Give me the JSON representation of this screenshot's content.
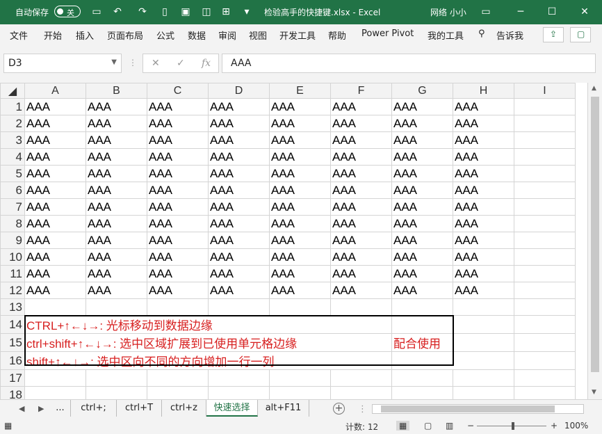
{
  "titlebar": {
    "autosave_label": "自动保存",
    "autosave_state": "关",
    "doc_title": "检验高手的快捷键.xlsx  -  Excel",
    "user": "网络 小小",
    "bg_color": "#217346"
  },
  "menu": {
    "items": [
      "文件",
      "开始",
      "插入",
      "页面布局",
      "公式",
      "数据",
      "审阅",
      "视图",
      "开发工具",
      "帮助",
      "Power Pivot",
      "我的工具",
      "告诉我"
    ]
  },
  "formula_bar": {
    "name_box": "D3",
    "fx_label": "fx",
    "cancel_glyph": "✕",
    "enter_glyph": "✓",
    "value": "AAA"
  },
  "grid": {
    "columns": [
      "A",
      "B",
      "C",
      "D",
      "E",
      "F",
      "G",
      "H",
      "I"
    ],
    "rows": [
      "1",
      "2",
      "3",
      "4",
      "5",
      "6",
      "7",
      "8",
      "9",
      "10",
      "11",
      "12",
      "13",
      "14",
      "15",
      "16",
      "17",
      "18"
    ],
    "fill_value": "AAA",
    "note_row14": "CTRL+↑←↓→: 光标移动到数据边缘",
    "note_row15": "ctrl+shift+↑←↓→:  选中区域扩展到已使用单元格边缘",
    "note_row15_right": "配合使用",
    "note_row16": "shift+↑←↓→:  选中区向不同的方向增加一行一列",
    "note_color": "#d71f1f"
  },
  "tabs": {
    "ellipsis": "...",
    "sheets": [
      "ctrl+;",
      "ctrl+T",
      "ctrl+z",
      "快速选择",
      "alt+F11"
    ],
    "active_index": 3
  },
  "status": {
    "count_label": "计数: 12",
    "zoom": "100%"
  }
}
